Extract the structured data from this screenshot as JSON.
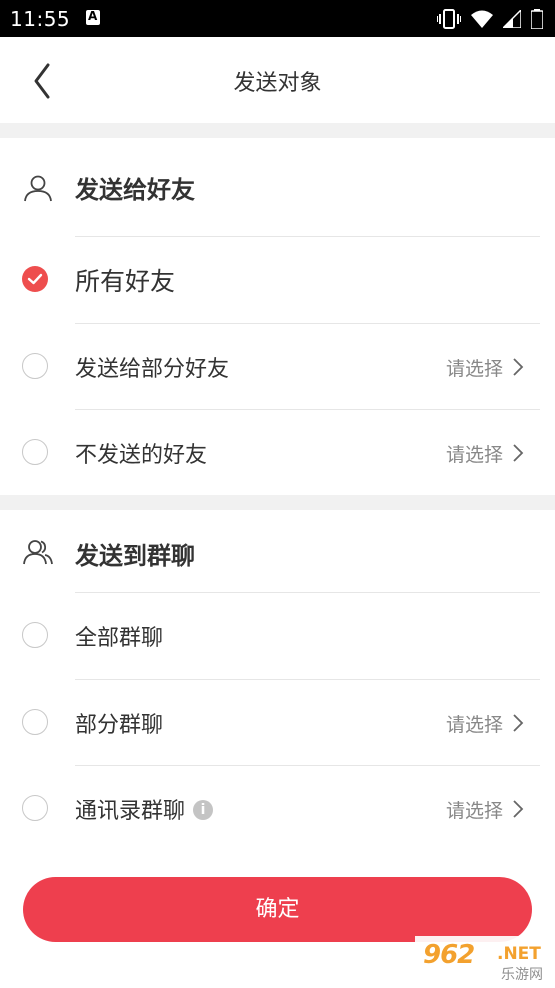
{
  "status_bar": {
    "time": "11:55"
  },
  "nav": {
    "title": "发送对象"
  },
  "friends_section": {
    "header": "发送给好友",
    "options": [
      {
        "label": "所有好友",
        "checked": true,
        "choose": ""
      },
      {
        "label": "发送给部分好友",
        "checked": false,
        "choose": "请选择"
      },
      {
        "label": "不发送的好友",
        "checked": false,
        "choose": "请选择"
      }
    ]
  },
  "groups_section": {
    "header": "发送到群聊",
    "options": [
      {
        "label": "全部群聊",
        "checked": false,
        "choose": ""
      },
      {
        "label": "部分群聊",
        "checked": false,
        "choose": "请选择"
      },
      {
        "label": "通讯录群聊",
        "checked": false,
        "choose": "请选择",
        "info_icon": "i"
      }
    ]
  },
  "confirm_button": {
    "label": "确定"
  },
  "watermark": {
    "number": "962",
    "suffix": ".NET",
    "site": "乐游网"
  },
  "colors": {
    "accent": "#ee3f4e",
    "checked": "#ee4e4e",
    "gap": "#f1f1f1"
  }
}
